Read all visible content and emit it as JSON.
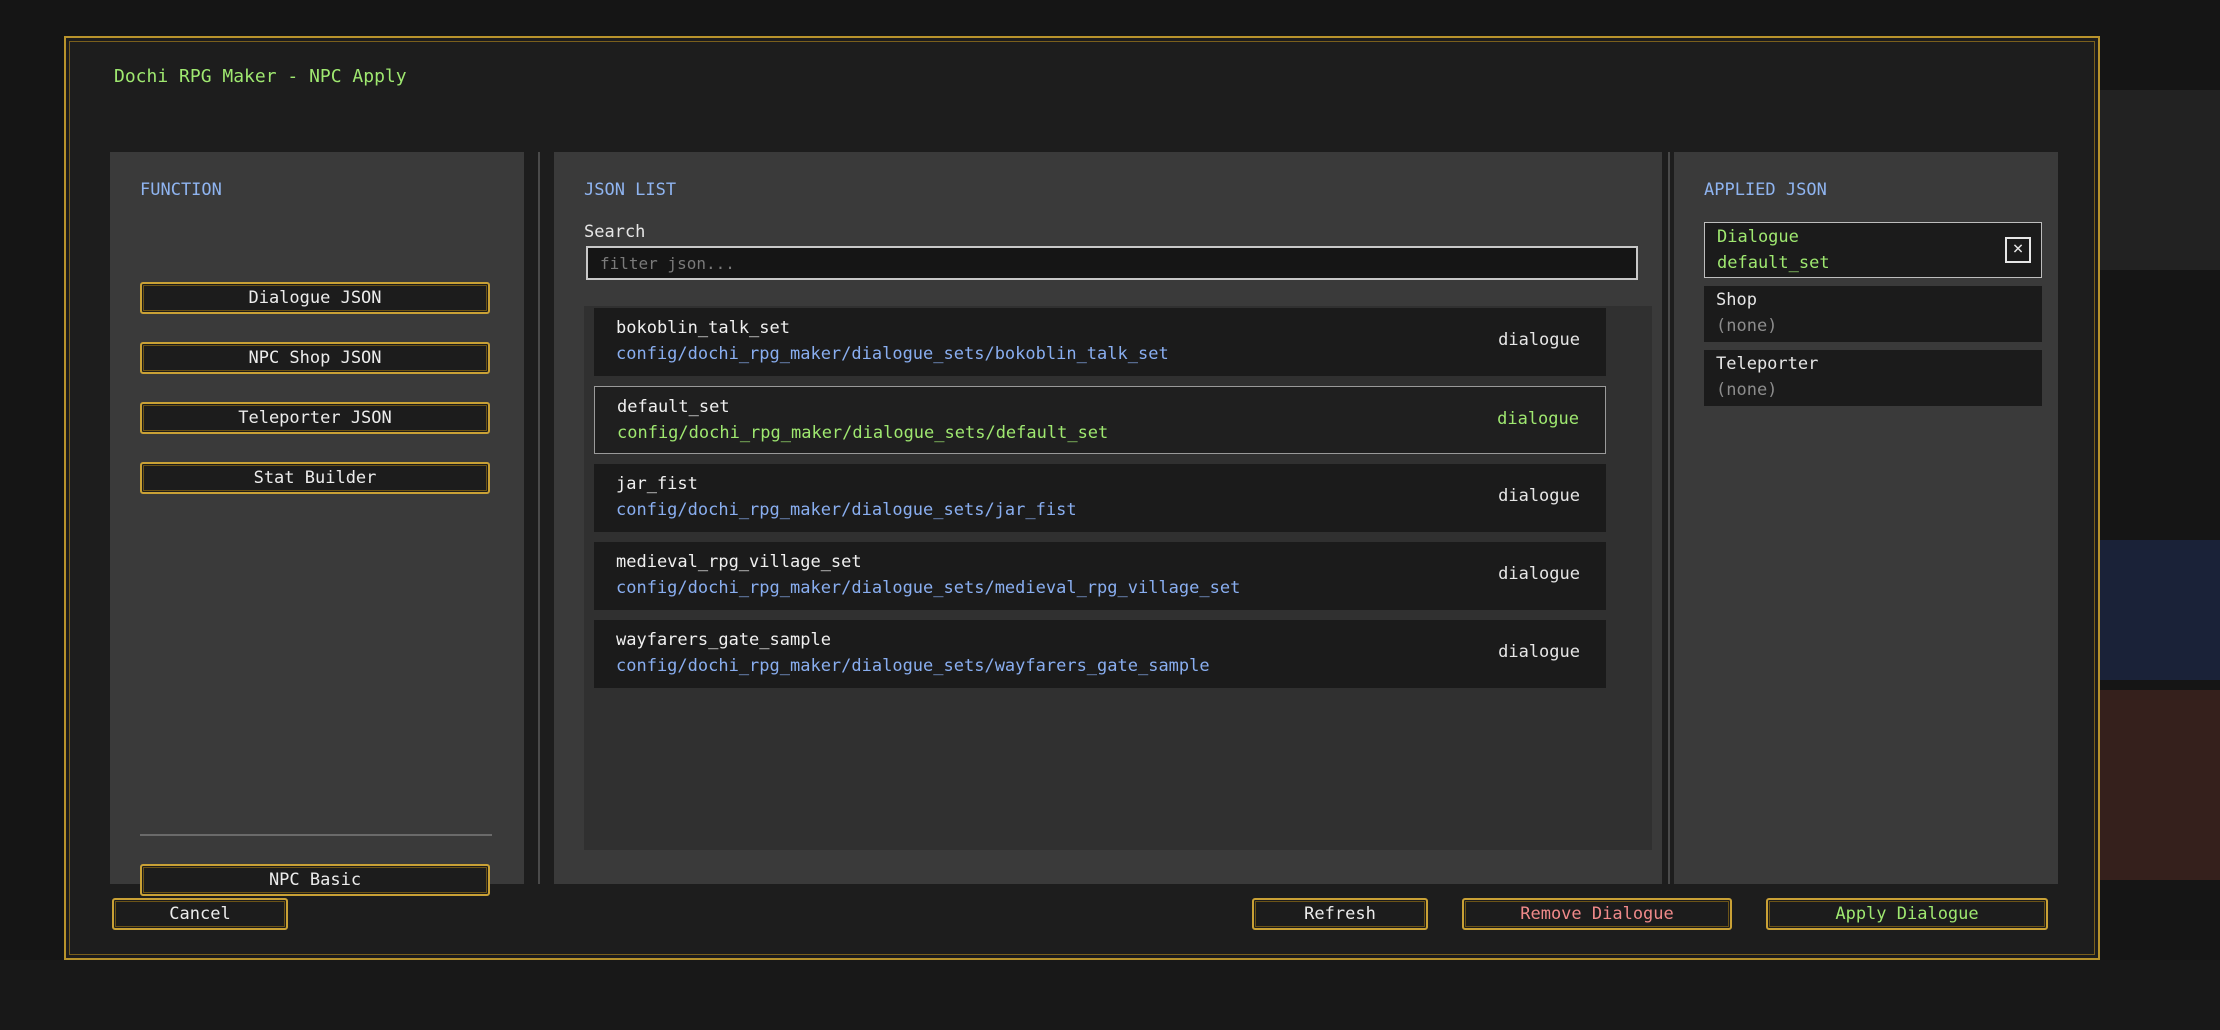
{
  "window": {
    "title": "Dochi RPG Maker - NPC Apply"
  },
  "function_panel": {
    "title": "FUNCTION",
    "buttons": [
      "Dialogue JSON",
      "NPC Shop JSON",
      "Teleporter JSON",
      "Stat Builder"
    ],
    "npc_basic": "NPC Basic"
  },
  "json_panel": {
    "title": "JSON LIST",
    "search_label": "Search",
    "search_placeholder": "filter json...",
    "items": [
      {
        "name": "bokoblin_talk_set",
        "path": "config/dochi_rpg_maker/dialogue_sets/bokoblin_talk_set",
        "type": "dialogue"
      },
      {
        "name": "default_set",
        "path": "config/dochi_rpg_maker/dialogue_sets/default_set",
        "type": "dialogue"
      },
      {
        "name": "jar_fist",
        "path": "config/dochi_rpg_maker/dialogue_sets/jar_fist",
        "type": "dialogue"
      },
      {
        "name": "medieval_rpg_village_set",
        "path": "config/dochi_rpg_maker/dialogue_sets/medieval_rpg_village_set",
        "type": "dialogue"
      },
      {
        "name": "wayfarers_gate_sample",
        "path": "config/dochi_rpg_maker/dialogue_sets/wayfarers_gate_sample",
        "type": "dialogue"
      }
    ]
  },
  "applied_panel": {
    "title": "APPLIED JSON",
    "cards": [
      {
        "label": "Dialogue",
        "value": "default_set"
      },
      {
        "label": "Shop",
        "value": "(none)"
      },
      {
        "label": "Teleporter",
        "value": "(none)"
      }
    ],
    "remove_icon": "close-x-icon"
  },
  "footer": {
    "cancel": "Cancel",
    "refresh": "Refresh",
    "remove": "Remove Dialogue",
    "apply": "Apply Dialogue"
  },
  "colors": {
    "accent_gold": "#c9a136",
    "selected_green": "#9fe870",
    "title_blue": "#8fb4f0",
    "remove_red": "#f08a8a"
  }
}
